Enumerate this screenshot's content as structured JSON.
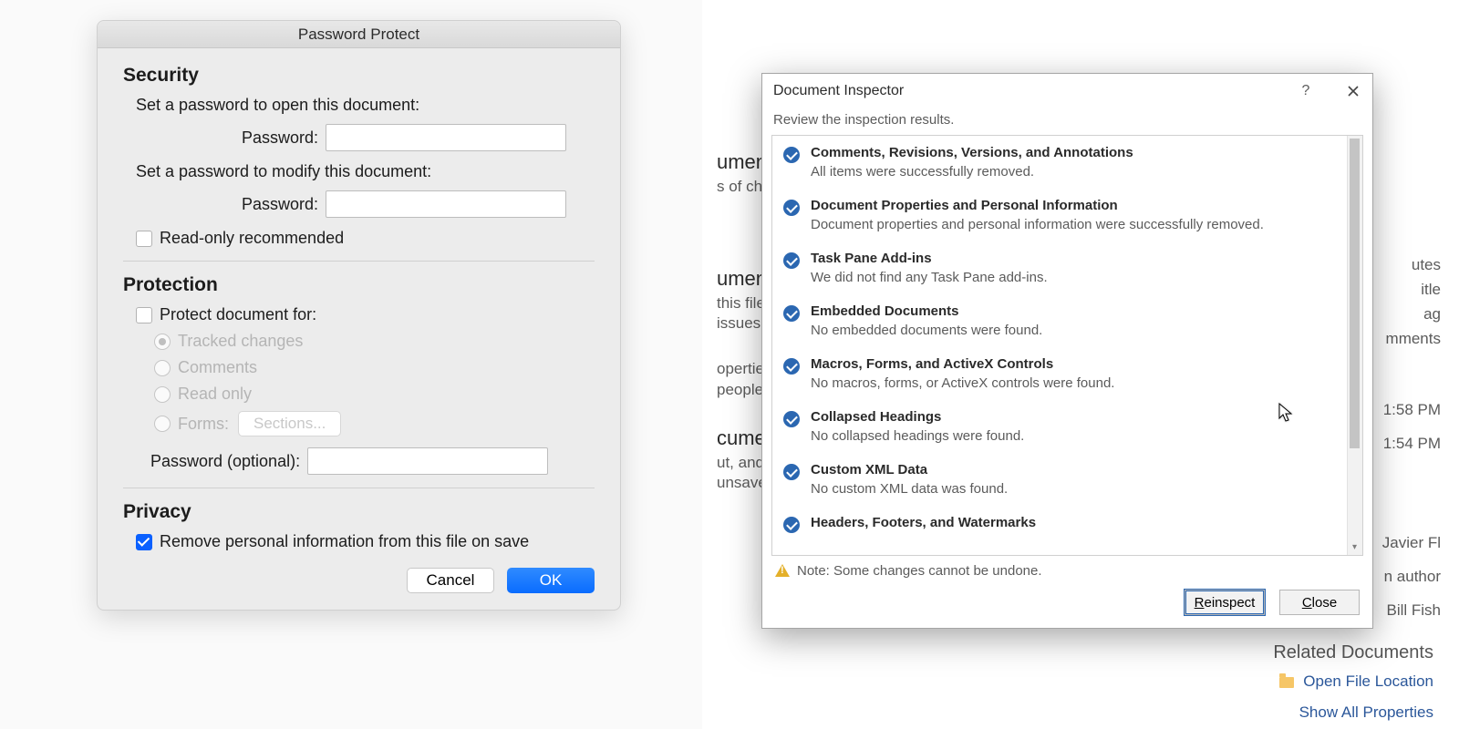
{
  "mac": {
    "title": "Password Protect",
    "security": {
      "heading": "Security",
      "open_label": "Set a password to open this document:",
      "modify_label": "Set a password to modify this document:",
      "password_label": "Password:",
      "readonly_label": "Read-only recommended"
    },
    "protection": {
      "heading": "Protection",
      "protect_for_label": "Protect document for:",
      "options": {
        "tracked": "Tracked changes",
        "comments": "Comments",
        "readonly": "Read only",
        "forms": "Forms:",
        "sections_btn": "Sections..."
      },
      "optional_pw_label": "Password (optional):"
    },
    "privacy": {
      "heading": "Privacy",
      "remove_label": "Remove personal information from this file on save"
    },
    "buttons": {
      "cancel": "Cancel",
      "ok": "OK"
    }
  },
  "inspector": {
    "title": "Document Inspector",
    "subtitle": "Review the inspection results.",
    "items": [
      {
        "title": "Comments, Revisions, Versions, and Annotations",
        "desc": "All items were successfully removed."
      },
      {
        "title": "Document Properties and Personal Information",
        "desc": "Document properties and personal information were successfully removed."
      },
      {
        "title": "Task Pane Add-ins",
        "desc": "We did not find any Task Pane add-ins."
      },
      {
        "title": "Embedded Documents",
        "desc": "No embedded documents were found."
      },
      {
        "title": "Macros, Forms, and ActiveX Controls",
        "desc": "No macros, forms, or ActiveX controls were found."
      },
      {
        "title": "Collapsed Headings",
        "desc": "No collapsed headings were found."
      },
      {
        "title": "Custom XML Data",
        "desc": "No custom XML data was found."
      },
      {
        "title": "Headers, Footers, and Watermarks",
        "desc": ""
      }
    ],
    "note": "Note: Some changes cannot be undone.",
    "buttons": {
      "reinspect": "Reinspect",
      "close": "Close",
      "help": "?"
    }
  },
  "backstage": {
    "frag1_head": "umen",
    "frag1_sub": "s of cha",
    "frag2_head": "umen",
    "frag2_l1": " this file",
    "frag2_l2": " issues",
    "frag3_l1": "operties",
    "frag3_l2": "people",
    "frag4_head": "cume",
    "frag4_l1": "ut, and",
    "frag4_l2": "unsaved",
    "right": {
      "utes": "utes",
      "itle": "itle",
      "ag": "ag",
      "mments": "mments",
      "t1": "1:58 PM",
      "t2": "1:54 PM",
      "p1": "Javier Fl",
      "p2": "n author",
      "p3": "Bill Fish"
    },
    "related_title": "Related Documents",
    "open_location": "Open File Location",
    "show_all": "Show All Properties"
  }
}
